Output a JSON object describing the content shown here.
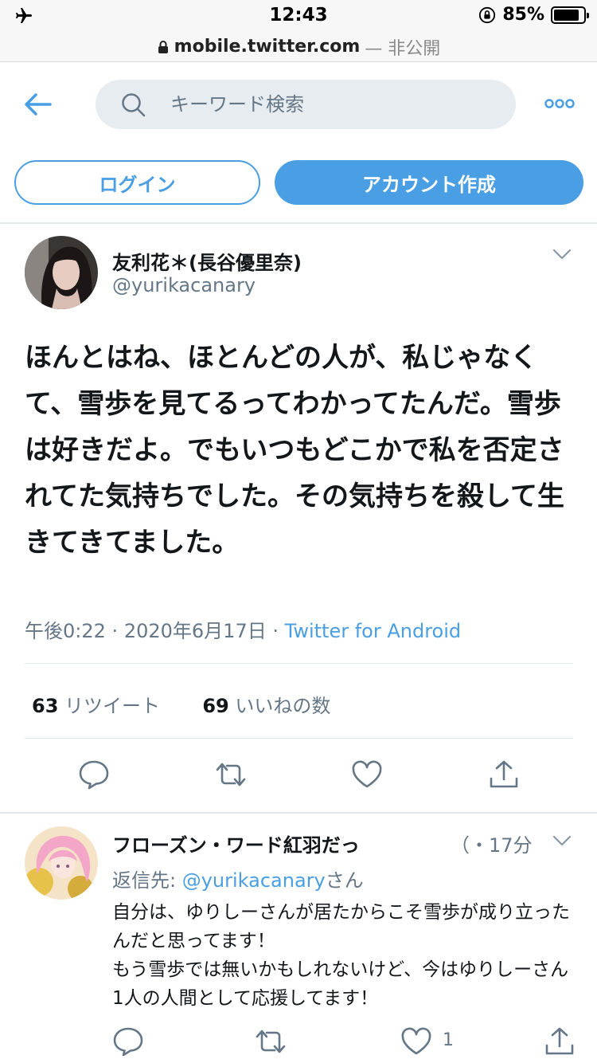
{
  "status_bar": {
    "time": "12:43",
    "battery_percent": "85%",
    "battery_level": 0.85
  },
  "url_bar": {
    "domain": "mobile.twitter.com",
    "privacy": "— 非公開"
  },
  "header": {
    "search_placeholder": "キーワード検索"
  },
  "auth": {
    "login_label": "ログイン",
    "signup_label": "アカウント作成"
  },
  "tweet": {
    "author_name": "友利花＊(長谷優里奈)",
    "author_handle": "@yurikacanary",
    "text": "ほんとはね、ほとんどの人が、私じゃなくて、雪歩を見てるってわかってたんだ。雪歩は好きだよ。でもいつもどこかで私を否定されてた気持ちでした。その気持ちを殺して生きてきてました。",
    "time": "午後0:22",
    "date": "2020年6月17日",
    "separator": "·",
    "source": "Twitter for Android",
    "retweet_count": "63",
    "retweet_label": "リツイート",
    "like_count": "69",
    "like_label": "いいねの数"
  },
  "reply": {
    "author_name": "フローズン・ワード紅羽だっ",
    "time": "（・17分",
    "reply_prefix": "返信先: ",
    "reply_mention": "@yurikacanary",
    "reply_suffix": "さん",
    "line1": "自分は、ゆりしーさんが居たからこそ雪歩が成り立ったんだと思ってます！",
    "line2": "もう雪歩では無いかもしれないけど、今はゆりしーさん 1人の人間として応援してます！",
    "like_count": "1"
  },
  "colors": {
    "accent": "#4a9ee3",
    "secondary_text": "#657786",
    "primary_text": "#14171a",
    "divider": "#e1e8ed"
  },
  "icons": {
    "status": [
      "airplane-icon",
      "rotation-lock-icon",
      "battery-icon"
    ],
    "url": [
      "lock-icon"
    ],
    "header": [
      "back-arrow-icon",
      "search-icon",
      "more-icon"
    ],
    "actions": [
      "reply-icon",
      "retweet-icon",
      "like-icon",
      "share-icon"
    ]
  }
}
